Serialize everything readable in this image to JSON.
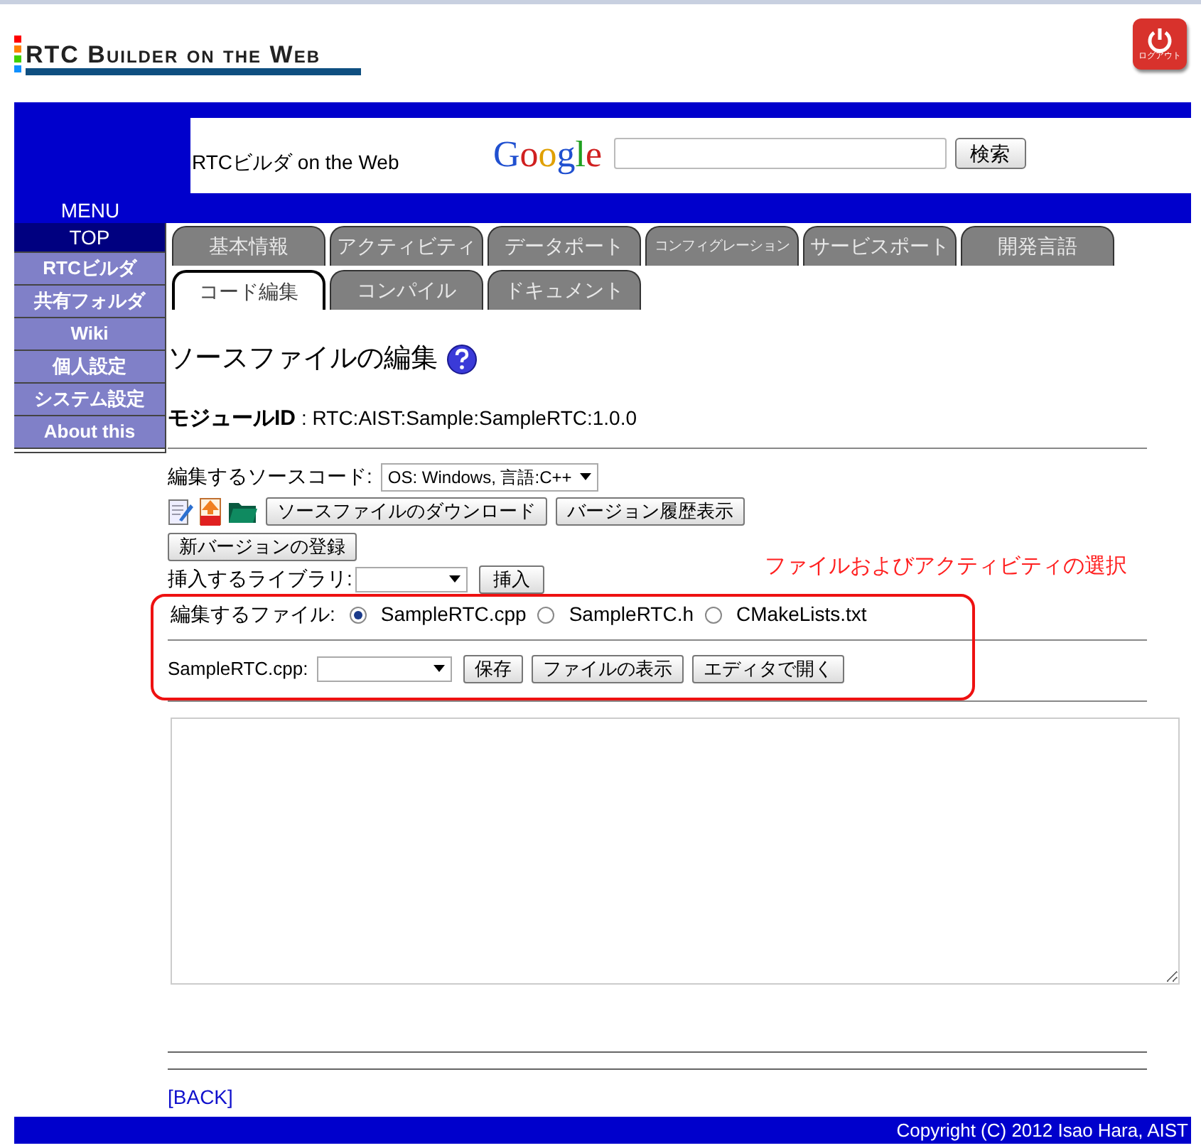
{
  "logo": {
    "title": "RTC Builder on the Web"
  },
  "logout": {
    "label": "ログアウト"
  },
  "header": {
    "site_title": "RTCビルダ on the Web",
    "search_logo": "Google",
    "search_button": "検索"
  },
  "menu": {
    "title": "MENU",
    "items": [
      {
        "label": "TOP",
        "selected": true
      },
      {
        "label": "RTCビルダ",
        "selected": false
      },
      {
        "label": "共有フォルダ",
        "selected": false
      },
      {
        "label": "Wiki",
        "selected": false
      },
      {
        "label": "個人設定",
        "selected": false
      },
      {
        "label": "システム設定",
        "selected": false
      },
      {
        "label": "About this",
        "selected": false
      }
    ]
  },
  "tabs": [
    [
      {
        "label": "基本情報",
        "selected": false
      },
      {
        "label": "アクティビティ",
        "selected": false
      },
      {
        "label": "データポート",
        "selected": false
      },
      {
        "label": "コンフィグレーション",
        "selected": false
      },
      {
        "label": "サービスポート",
        "selected": false
      },
      {
        "label": "開発言語",
        "selected": false
      }
    ],
    [
      {
        "label": "コード編集",
        "selected": true
      },
      {
        "label": "コンパイル",
        "selected": false
      },
      {
        "label": "ドキュメント",
        "selected": false
      }
    ]
  ],
  "heading": "ソースファイルの編集",
  "module_id": {
    "label": "モジュールID",
    "value": ": RTC:AIST:Sample:SampleRTC:1.0.0"
  },
  "source_code": {
    "label": "編集するソースコード:",
    "value": "OS: Windows, 言語:C++"
  },
  "toolbar_buttons": [
    "ソースファイルのダウンロード",
    "バージョン履歴表示"
  ],
  "register_button": "新バージョンの登録",
  "library": {
    "label": "挿入するライブラリ:",
    "button": "挿入"
  },
  "annotation": "ファイルおよびアクティビティの選択",
  "files": {
    "label": "編集するファイル:",
    "options": [
      {
        "label": "SampleRTC.cpp",
        "selected": true
      },
      {
        "label": "SampleRTC.h",
        "selected": false
      },
      {
        "label": "CMakeLists.txt",
        "selected": false
      }
    ]
  },
  "file_action": {
    "label": "SampleRTC.cpp:",
    "buttons": [
      "保存",
      "ファイルの表示",
      "エディタで開く"
    ]
  },
  "back_link": "[BACK]",
  "footer": "Copyright (C) 2012 Isao Hara, AIST"
}
